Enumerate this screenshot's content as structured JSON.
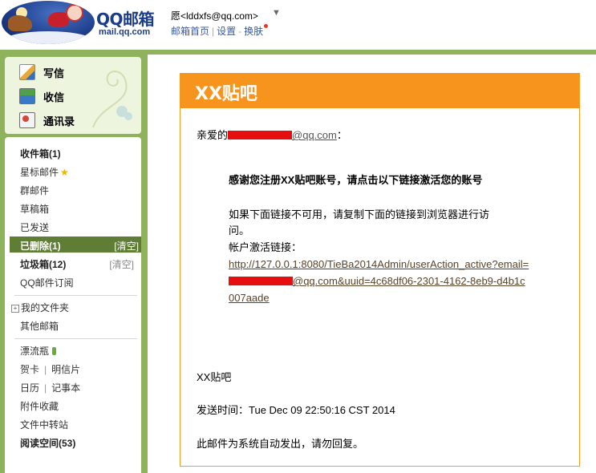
{
  "header": {
    "logo_text": "QQ邮箱",
    "logo_url": "mail.qq.com",
    "user": "愿<lddxfs@qq.com>",
    "user_caret": "▼",
    "links": [
      "邮箱首页",
      "设置",
      "换肤"
    ]
  },
  "actions": {
    "write": "写信",
    "receive": "收信",
    "contacts": "通讯录"
  },
  "folders": {
    "inbox": "收件箱(1)",
    "starred": "星标邮件",
    "group": "群邮件",
    "drafts": "草稿箱",
    "sent": "已发送",
    "deleted": "已删除(1)",
    "deleted_clear": "[清空]",
    "spam": "垃圾箱(12)",
    "spam_clear": "[清空]",
    "subscriptions": "QQ邮件订阅",
    "my_folders": "我的文件夹",
    "other_mailbox": "其他邮箱",
    "drift_bottle": "漂流瓶",
    "greeting_card": "贺卡",
    "postcard": "明信片",
    "calendar": "日历",
    "notes": "记事本",
    "attachments": "附件收藏",
    "file_transfer": "文件中转站",
    "reading": "阅读空间(53)"
  },
  "mail": {
    "title": "XX贴吧",
    "greeting_prefix": "亲爱的",
    "greeting_email_suffix": "@qq.com",
    "greeting_colon": "：",
    "thanks": "感谢您注册XX贴吧账号，请点击以下链接激活您的账号",
    "fallback_line1": "如果下面链接不可用，请复制下面的链接到浏览器进行访",
    "fallback_line2": "问。",
    "activation_label": "帐户激活链接：",
    "link_part1": "http://127.0.0.1:8080/TieBa2014Admin/userAction_active?email=",
    "link_part2": "@qq.com&uuid=4c68df06-2301-4162-8eb9-d4b1c007aade",
    "signature": "XX贴吧",
    "sent_time": "发送时间：Tue Dec 09 22:50:16 CST 2014",
    "auto_notice": "此邮件为系统自动发出，请勿回复。"
  },
  "colors": {
    "accent_green": "#8fb35d",
    "selected_green": "#5f7d35",
    "mail_orange": "#f7941d",
    "redaction": "#e60f0f"
  }
}
